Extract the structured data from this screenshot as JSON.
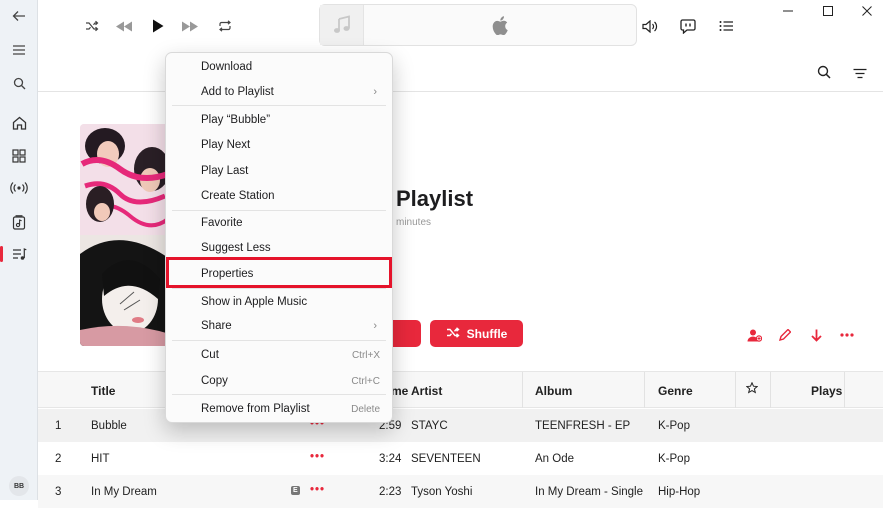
{
  "sidebar": {
    "avatar_initials": "BB"
  },
  "player": {
    "icons": [
      "back-icon",
      "menu-icon",
      "search-icon",
      "home-icon",
      "browse-icon",
      "radio-icon",
      "library-icon",
      "playlist-icon",
      "shuffle-icon",
      "previous-icon",
      "play-icon",
      "next-icon",
      "repeat-icon",
      "note-icon",
      "apple-logo",
      "volume-icon",
      "lyrics-icon",
      "queue-icon"
    ]
  },
  "playlist": {
    "title": "Playlist",
    "meta": "minutes",
    "shuffle_label": "Shuffle",
    "accent": "#e8283c"
  },
  "table": {
    "headers": {
      "title": "Title",
      "time": "me",
      "artist": "Artist",
      "album": "Album",
      "genre": "Genre",
      "plays": "Plays"
    },
    "rows": [
      {
        "num": "1",
        "title": "Bubble",
        "time": "2:59",
        "artist": "STAYC",
        "album": "TEENFRESH - EP",
        "genre": "K-Pop",
        "explicit": ""
      },
      {
        "num": "2",
        "title": "HIT",
        "time": "3:24",
        "artist": "SEVENTEEN",
        "album": "An Ode",
        "genre": "K-Pop",
        "explicit": ""
      },
      {
        "num": "3",
        "title": "In My Dream",
        "time": "2:23",
        "artist": "Tyson Yoshi",
        "album": "In My Dream - Single",
        "genre": "Hip-Hop",
        "explicit": "E"
      }
    ]
  },
  "context_menu": {
    "items": [
      {
        "label": "Download"
      },
      {
        "label": "Add to Playlist",
        "arrow": "›"
      },
      {
        "label": "Play “Bubble”"
      },
      {
        "label": "Play Next"
      },
      {
        "label": "Play Last"
      },
      {
        "label": "Create Station"
      },
      {
        "label": "Favorite"
      },
      {
        "label": "Suggest Less"
      },
      {
        "label": "Properties"
      },
      {
        "label": "Show in Apple Music"
      },
      {
        "label": "Share",
        "arrow": "›"
      },
      {
        "label": "Cut",
        "shortcut": "Ctrl+X"
      },
      {
        "label": "Copy",
        "shortcut": "Ctrl+C"
      },
      {
        "label": "Remove from Playlist",
        "shortcut": "Delete"
      }
    ],
    "highlight_color": "#e5132b"
  }
}
